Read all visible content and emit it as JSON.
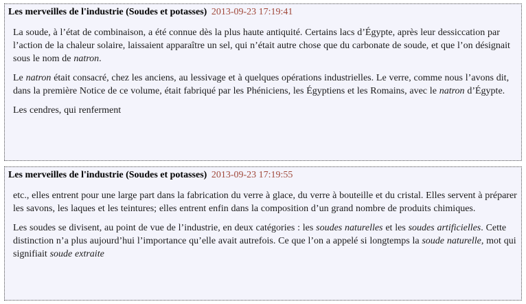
{
  "entries": [
    {
      "title": "Les merveilles de l'industrie (Soudes et potasses)",
      "date": "2013-09-23 17:19:41",
      "paragraphs": [
        [
          {
            "t": "La soude, à l’état de combinaison, a été connue dès la plus haute antiquité. Certains lacs d’Égypte, après leur dessiccation par l’action de la chaleur solaire, laissaient apparaître un sel, qui n’était autre chose que du carbonate de soude, et que l’on désignait sous le nom de "
          },
          {
            "t": "natron",
            "i": true
          },
          {
            "t": "."
          }
        ],
        [
          {
            "t": "Le "
          },
          {
            "t": "natron",
            "i": true
          },
          {
            "t": " était consacré, chez les anciens, au lessivage et à quelques opérations industrielles. Le verre, comme nous l’avons dit, dans la première Notice de ce volume, était fabriqué par les Phéniciens, les Égyptiens et les Romains, avec le "
          },
          {
            "t": "natron",
            "i": true
          },
          {
            "t": " d’Égypte."
          }
        ],
        [
          {
            "t": "Les cendres, qui renferment"
          }
        ]
      ]
    },
    {
      "title": "Les merveilles de l'industrie (Soudes et potasses)",
      "date": "2013-09-23 17:19:55",
      "paragraphs": [
        [
          {
            "t": "etc., elles entrent pour une large part dans la fabrication du verre à glace, du verre à bouteille et du cristal. Elles servent à préparer les savons, les laques et les teintures; elles entrent enfin dans la composition d’un grand nombre de produits chimiques."
          }
        ],
        [
          {
            "t": "Les soudes se divisent, au point de vue de l’industrie, en deux catégories : les "
          },
          {
            "t": "soudes naturelles",
            "i": true
          },
          {
            "t": " et les "
          },
          {
            "t": "soudes artificielles",
            "i": true
          },
          {
            "t": ". Cette distinction n’a plus aujourd’hui l’importance qu’elle avait autrefois. Ce que l’on a appelé si longtemps la "
          },
          {
            "t": "soude naturelle",
            "i": true
          },
          {
            "t": ", mot qui signifiait "
          },
          {
            "t": "soude extraite",
            "i": true
          }
        ]
      ]
    }
  ]
}
